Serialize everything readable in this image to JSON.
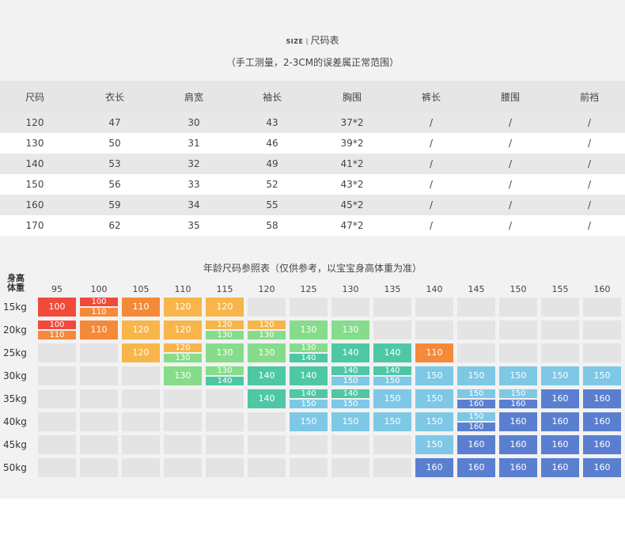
{
  "header": {
    "size_tag": "SIZE",
    "separator": "|",
    "title": "尺码表",
    "subtitle": "（手工测量，2-3CM的误差属正常范围）"
  },
  "size_table": {
    "columns": [
      "尺码",
      "衣长",
      "肩宽",
      "袖长",
      "胸围",
      "裤长",
      "腰围",
      "前裆"
    ],
    "rows": [
      [
        "120",
        "47",
        "30",
        "43",
        "37*2",
        "/",
        "/",
        "/"
      ],
      [
        "130",
        "50",
        "31",
        "46",
        "39*2",
        "/",
        "/",
        "/"
      ],
      [
        "140",
        "53",
        "32",
        "49",
        "41*2",
        "/",
        "/",
        "/"
      ],
      [
        "150",
        "56",
        "33",
        "52",
        "43*2",
        "/",
        "/",
        "/"
      ],
      [
        "160",
        "59",
        "34",
        "55",
        "45*2",
        "/",
        "/",
        "/"
      ],
      [
        "170",
        "62",
        "35",
        "58",
        "47*2",
        "/",
        "/",
        "/"
      ]
    ]
  },
  "reference_chart": {
    "title": "年龄尺码参照表（仅供参考，以宝宝身高体重为准）",
    "corner_top": "身高",
    "corner_bottom": "体重",
    "heights": [
      "95",
      "100",
      "105",
      "110",
      "115",
      "120",
      "125",
      "130",
      "135",
      "140",
      "145",
      "150",
      "155",
      "160"
    ],
    "weights": [
      "15kg",
      "20kg",
      "25kg",
      "30kg",
      "35kg",
      "40kg",
      "45kg",
      "50kg"
    ],
    "size_colors": {
      "100": "#f04a3a",
      "110": "#f5893a",
      "120": "#f8b54a",
      "130": "#86dc8a",
      "140": "#4ec7a4",
      "150": "#7ec8e6",
      "160": "#5a7fd0"
    },
    "grid": [
      [
        [
          "100"
        ],
        [
          "100",
          "110"
        ],
        [
          "110"
        ],
        [
          "120"
        ],
        [
          "120"
        ],
        [],
        [],
        [],
        [],
        [],
        [],
        [],
        [],
        []
      ],
      [
        [
          "100",
          "110"
        ],
        [
          "110"
        ],
        [
          "120"
        ],
        [
          "120"
        ],
        [
          "120",
          "130"
        ],
        [
          "120",
          "130"
        ],
        [
          "130"
        ],
        [
          "130"
        ],
        [],
        [],
        [],
        [],
        [],
        []
      ],
      [
        [],
        [],
        [
          "120"
        ],
        [
          "120",
          "130"
        ],
        [
          "130"
        ],
        [
          "130"
        ],
        [
          "130",
          "140"
        ],
        [
          "140"
        ],
        [
          "140"
        ],
        [
          "110"
        ],
        [],
        [],
        [],
        []
      ],
      [
        [],
        [],
        [],
        [
          "130"
        ],
        [
          "130",
          "140"
        ],
        [
          "140"
        ],
        [
          "140"
        ],
        [
          "140",
          "150"
        ],
        [
          "140",
          "150"
        ],
        [
          "150"
        ],
        [
          "150"
        ],
        [
          "150"
        ],
        [
          "150"
        ],
        [
          "150"
        ]
      ],
      [
        [],
        [],
        [],
        [],
        [],
        [
          "140"
        ],
        [
          "140",
          "150"
        ],
        [
          "140",
          "150"
        ],
        [
          "150"
        ],
        [
          "150"
        ],
        [
          "150",
          "160"
        ],
        [
          "150",
          "160"
        ],
        [
          "160"
        ],
        [
          "160"
        ]
      ],
      [
        [],
        [],
        [],
        [],
        [],
        [],
        [
          "150"
        ],
        [
          "150"
        ],
        [
          "150"
        ],
        [
          "150"
        ],
        [
          "150",
          "160"
        ],
        [
          "160"
        ],
        [
          "160"
        ],
        [
          "160"
        ]
      ],
      [
        [],
        [],
        [],
        [],
        [],
        [],
        [],
        [],
        [],
        [
          "150"
        ],
        [
          "160"
        ],
        [
          "160"
        ],
        [
          "160"
        ],
        [
          "160"
        ]
      ],
      [
        [],
        [],
        [],
        [],
        [],
        [],
        [],
        [],
        [],
        [
          "160"
        ],
        [
          "160"
        ],
        [
          "160"
        ],
        [
          "160"
        ],
        [
          "160"
        ]
      ]
    ]
  }
}
